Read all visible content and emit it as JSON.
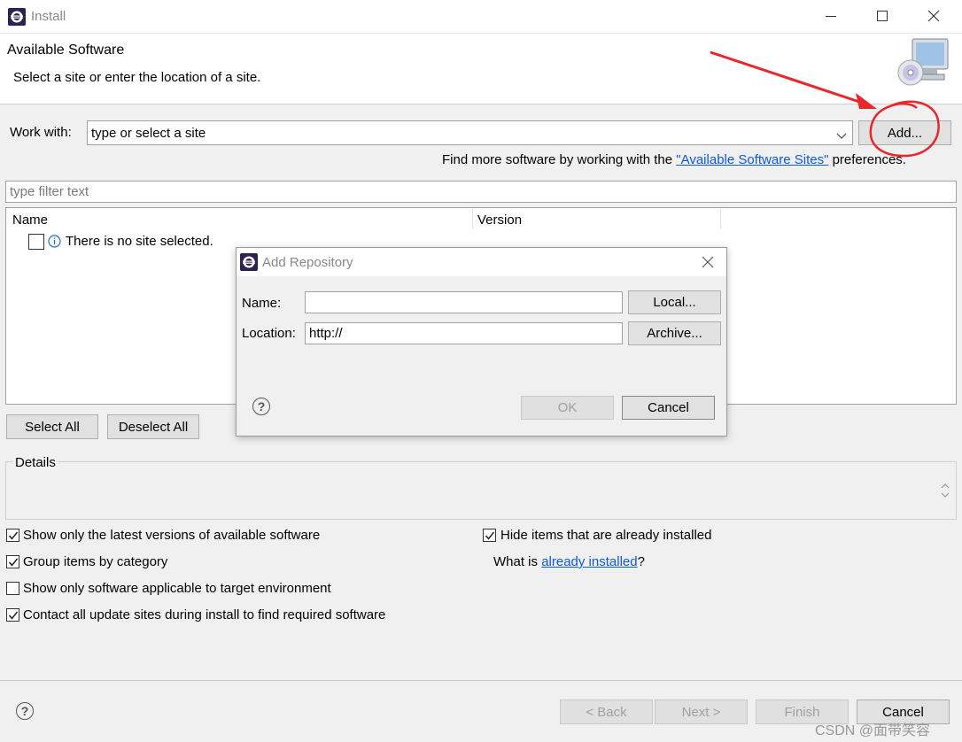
{
  "window": {
    "title": "Install",
    "header_title": "Available Software",
    "header_subtitle": "Select a site or enter the location of a site."
  },
  "work_with": {
    "label": "Work with:",
    "placeholder": "type or select a site",
    "add_button": "Add..."
  },
  "find_more": {
    "prefix": "Find more software by working with the ",
    "link": "\"Available Software Sites\"",
    "suffix": " preferences."
  },
  "filter": {
    "placeholder": "type filter text"
  },
  "table": {
    "columns": [
      "Name",
      "Version"
    ],
    "message": "There is no site selected."
  },
  "selection_buttons": {
    "select_all": "Select All",
    "deselect_all": "Deselect All"
  },
  "details": {
    "label": "Details"
  },
  "options": {
    "latest_versions": {
      "label": "Show only the latest versions of available software",
      "checked": true
    },
    "group_by_category": {
      "label": "Group items by category",
      "checked": true
    },
    "target_env": {
      "label": "Show only software applicable to target environment",
      "checked": false
    },
    "contact_sites": {
      "label": "Contact all update sites during install to find required software",
      "checked": true
    },
    "hide_installed": {
      "label": "Hide items that are already installed",
      "checked": true
    },
    "what_is_prefix": "What is ",
    "what_is_link": "already installed",
    "what_is_suffix": "?"
  },
  "footer": {
    "back": "< Back",
    "next": "Next >",
    "finish": "Finish",
    "cancel": "Cancel"
  },
  "dialog": {
    "title": "Add Repository",
    "name_label": "Name:",
    "name_value": "",
    "location_label": "Location:",
    "location_value": "http://",
    "local_button": "Local...",
    "archive_button": "Archive...",
    "ok_button": "OK",
    "cancel_button": "Cancel"
  },
  "watermark": "CSDN @面带笑容",
  "colors": {
    "annotation": "#e8262b",
    "link": "#0b5ad8"
  }
}
